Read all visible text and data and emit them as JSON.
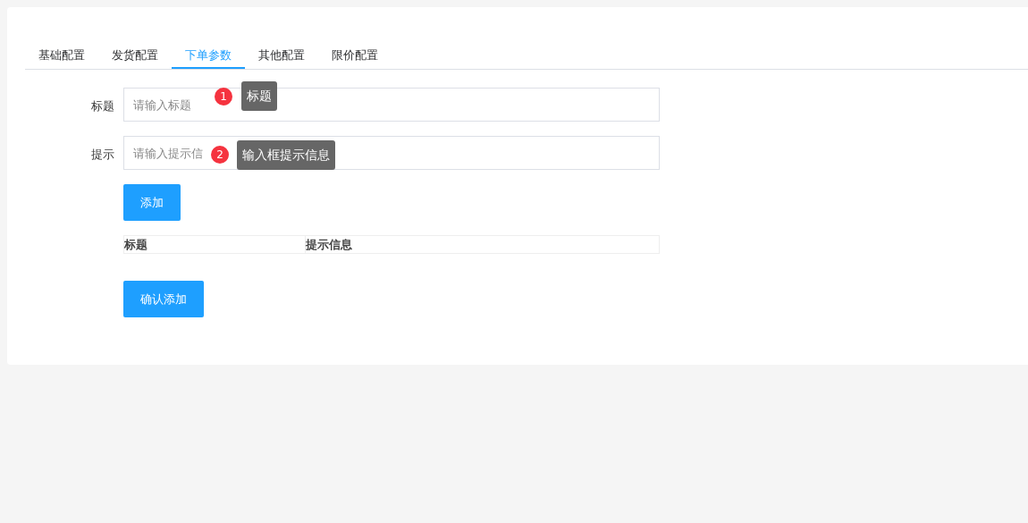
{
  "tabs": [
    {
      "label": "基础配置",
      "selected": false
    },
    {
      "label": "发货配置",
      "selected": false
    },
    {
      "label": "下单参数",
      "selected": true
    },
    {
      "label": "其他配置",
      "selected": false
    },
    {
      "label": "限价配置",
      "selected": false
    }
  ],
  "fields": [
    {
      "label": "标题",
      "placeholder": "请输入标题",
      "badge": "1",
      "tooltip": "标题"
    },
    {
      "label": "提示",
      "placeholder": "请输入提示信",
      "badge": "2",
      "tooltip": "输入框提示信息"
    }
  ],
  "add_button": "添加",
  "table": {
    "columns": [
      "标题",
      "提示信息"
    ]
  },
  "confirm_button": "确认添加"
}
